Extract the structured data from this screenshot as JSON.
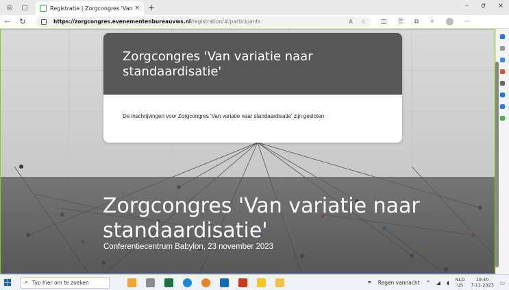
{
  "browser": {
    "tab_title": "Registratie | Zorgcongres 'Van va",
    "tab_close": "×",
    "new_tab": "+",
    "url_host": "https://zorgcongres.evenementenbureauvws.nl",
    "url_path": "/registration/#/participants",
    "window_controls": [
      "–",
      "σ",
      "×"
    ]
  },
  "page": {
    "card_title": "Zorgcongres 'Van variatie naar standaardisatie'",
    "card_message": "De inschrijvingen voor Zorgcongres 'Van variatie naar standaardisatie' zijn gesloten",
    "hero_title": "Zorgcongres 'Van variatie naar standaardisatie'",
    "hero_subtitle": "Conferentiecentrum Babylon, 23 november 2023"
  },
  "taskbar": {
    "search_placeholder": "Typ hier om te zoeken",
    "weather": "Regen vannacht",
    "lang_top": "NLD",
    "lang_bottom": "US",
    "time": "19:40",
    "date": "7-11-2023"
  },
  "colors": {
    "card_header": "#575757",
    "accent_green": "#2a9d3a"
  }
}
